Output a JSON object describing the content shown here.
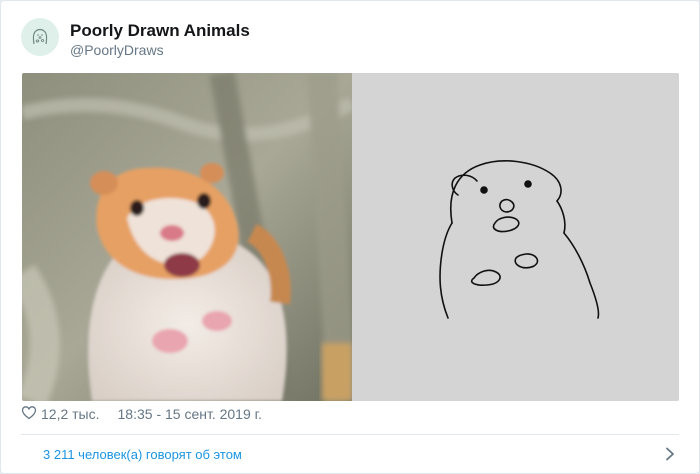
{
  "account": {
    "name": "Poorly Drawn Animals",
    "handle": "@PoorlyDraws",
    "avatar_icon": "hamster-doodle-icon"
  },
  "media": {
    "left_image": "scared-hamster-photo",
    "right_image": "hamster-line-drawing"
  },
  "stats": {
    "likes": "12,2 тыс.",
    "timestamp": "18:35 - 15 сент. 2019 г.",
    "like_icon": "heart-icon"
  },
  "footer": {
    "talking_text": "3 211 человек(а) говорят об этом",
    "chevron_icon": "chevron-right-icon"
  },
  "colors": {
    "link": "#1b95e0",
    "muted": "#657786",
    "text": "#14171a"
  }
}
